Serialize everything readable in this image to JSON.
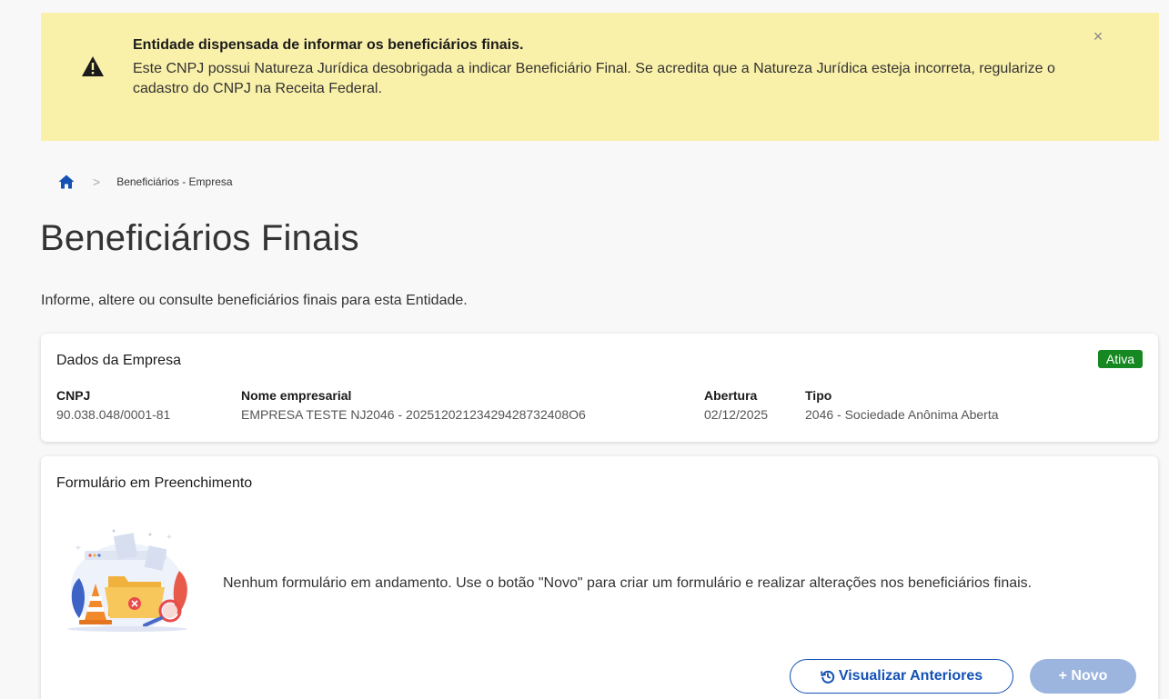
{
  "alert": {
    "title": "Entidade dispensada de informar os beneficiários finais.",
    "body": "Este CNPJ possui Natureza Jurídica desobrigada a indicar Beneficiário Final. Se acredita que a Natureza Jurídica esteja incorreta, regularize o cadastro do CNPJ na Receita Federal.",
    "close_glyph": "×",
    "icon": "warning-icon"
  },
  "breadcrumb": {
    "home_icon": "home-icon",
    "separator": ">",
    "current": "Beneficiários - Empresa"
  },
  "page": {
    "title": "Beneficiários Finais",
    "subtitle": "Informe, altere ou consulte beneficiários finais para esta Entidade."
  },
  "company": {
    "title": "Dados da Empresa",
    "status": "Ativa",
    "status_color": "#168821",
    "fields": [
      {
        "label": "CNPJ",
        "value": "90.038.048/0001-81"
      },
      {
        "label": "Nome empresarial",
        "value": "EMPRESA TESTE NJ2046 - 20251202123429428732408O6"
      },
      {
        "label": "Abertura",
        "value": "02/12/2025"
      },
      {
        "label": "Tipo",
        "value": "2046 - Sociedade Anônima Aberta"
      }
    ]
  },
  "form": {
    "title": "Formulário em Preenchimento",
    "empty_message": "Nenhum formulário em andamento. Use o botão \"Novo\" para criar um formulário e realizar alterações nos beneficiários finais.",
    "illustration": "empty-folder-illustration",
    "buttons": {
      "previous_label": "Visualizar Anteriores",
      "previous_icon": "history-icon",
      "new_label": "+ Novo"
    }
  },
  "colors": {
    "alert_bg": "#f9f0a9",
    "primary": "#1351b4",
    "primary_disabled": "#9bb5de"
  }
}
